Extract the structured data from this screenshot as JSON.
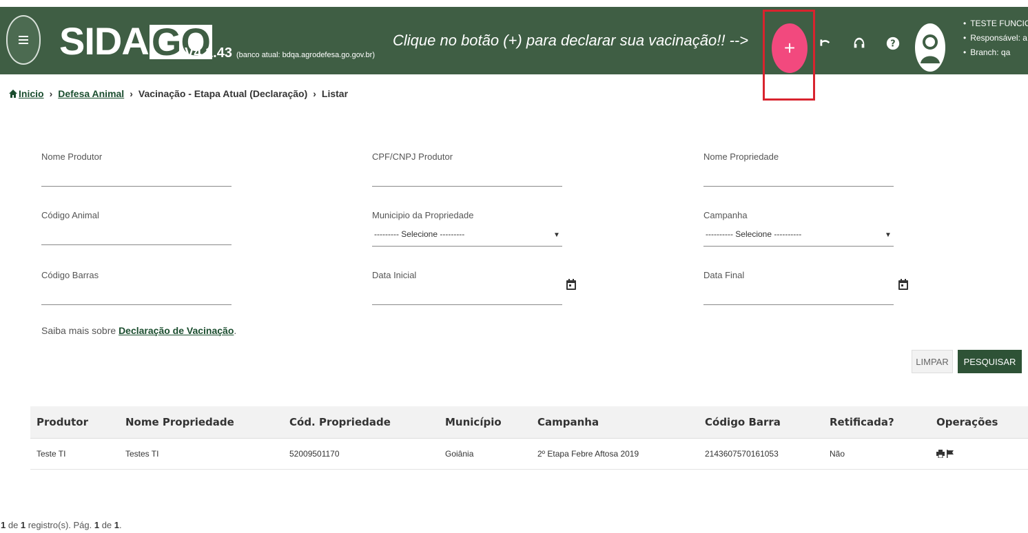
{
  "header": {
    "logo_sid": "SID",
    "logo_a": "A",
    "logo_go": "GO",
    "version": "V4.1.43",
    "bank": "(banco atual: bdqa.agrodefesa.go.gov.br)",
    "slogan": "Clique no botão (+) para declarar sua vacinação!! -->",
    "add_button": "+",
    "user_items": [
      "TESTE FUNCIO",
      "Responsável: a",
      "Branch: qa"
    ]
  },
  "breadcrumb": {
    "home": "Inicio",
    "level1": "Defesa Animal",
    "level2": "Vacinação - Etapa Atual (Declaração)",
    "level3": "Listar",
    "separator": "›"
  },
  "form": {
    "nome_produtor": {
      "label": "Nome Produtor",
      "value": ""
    },
    "cpf_cnpj": {
      "label": "CPF/CNPJ Produtor",
      "value": ""
    },
    "nome_propriedade": {
      "label": "Nome Propriedade",
      "value": ""
    },
    "codigo_animal": {
      "label": "Código Animal",
      "value": ""
    },
    "municipio": {
      "label": "Municipio da Propriedade",
      "selected": "--------- Selecione ---------"
    },
    "campanha": {
      "label": "Campanha",
      "selected": "---------- Selecione ----------"
    },
    "codigo_barras": {
      "label": "Código Barras",
      "value": ""
    },
    "data_inicial": {
      "label": "Data Inicial",
      "value": ""
    },
    "data_final": {
      "label": "Data Final",
      "value": ""
    }
  },
  "info": {
    "prefix": "Saiba mais sobre ",
    "link": "Declaração de Vacinação",
    "suffix": "."
  },
  "buttons": {
    "clear": "LIMPAR",
    "search": "PESQUISAR"
  },
  "table": {
    "headers": [
      "Produtor",
      "Nome Propriedade",
      "Cód. Propriedade",
      "Município",
      "Campanha",
      "Código Barra",
      "Retificada?",
      "Operações"
    ],
    "rows": [
      [
        "Teste TI",
        "Testes TI",
        "52009501170",
        "Goiânia",
        "2º Etapa Febre Aftosa 2019",
        "2143607570161053",
        "Não"
      ]
    ]
  },
  "pagination": {
    "count": "1",
    "count_suffix": " de ",
    "total": "1",
    "records_label": " registro(s). Pág. ",
    "page": "1",
    "page_sep": " de ",
    "pages": "1",
    "end": "."
  },
  "colors": {
    "header_bg": "#3f5e44",
    "accent_pink": "#f2497e",
    "highlight_red": "#d9232e",
    "primary_dark": "#2e5236"
  }
}
